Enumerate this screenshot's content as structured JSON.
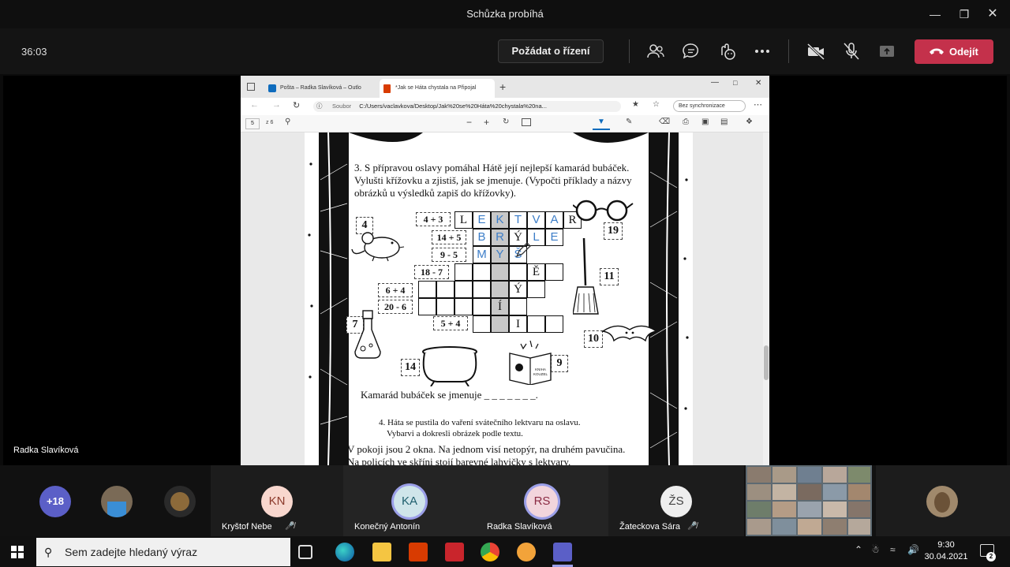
{
  "window": {
    "title": "Schůzka probíhá",
    "controls": [
      "minimize",
      "maximize",
      "close"
    ]
  },
  "meeting": {
    "timer": "36:03",
    "request_control_label": "Požádat o řízení",
    "leave_label": "Odejít",
    "leave_color": "#c4314b",
    "toolbar_icons": [
      "people-icon",
      "chat-icon",
      "reactions-icon",
      "more-icon",
      "camera-off-icon",
      "mic-off-icon",
      "share-icon"
    ]
  },
  "presenter_name": "Radka Slavíková",
  "browser": {
    "tabs": [
      {
        "label": "Pošta – Radka Slavíková – Outlo",
        "active": false
      },
      {
        "label": "*Jak se Háta chystala na Připojal",
        "active": true
      }
    ],
    "address_label": "Soubor",
    "url": "C:/Users/vaclavkova/Desktop/Jak%20se%20Háta%20chystala%20na...",
    "sync_label": "Bez synchronizace",
    "page_current": "5",
    "page_total": "z 6"
  },
  "worksheet": {
    "task3_lines": [
      "3. S přípravou oslavy pomáhal Hátě její nejlepší kamarád bubáček.",
      "Vylušti křížovku a zjistiš, jak se jmenuje. (Vypočti příklady a názvy",
      "obrázků u výsledků zapiš do křížovky)."
    ],
    "crossword_clues": [
      "4 + 3",
      "14 + 5",
      "9 - 5",
      "18 - 7",
      "6 + 4",
      "20 - 6",
      "5 + 4"
    ],
    "picture_numbers": [
      "4",
      "19",
      "11",
      "7",
      "10",
      "14",
      "9"
    ],
    "rows": [
      [
        "L",
        "E",
        "K",
        "T",
        "V",
        "A",
        "R"
      ],
      [
        "B",
        "R",
        "Ý",
        "L",
        "E"
      ],
      [
        "M",
        "Y",
        "Š"
      ],
      [
        "Ě"
      ],
      [
        "Ý"
      ],
      [
        "Í"
      ],
      [
        "I"
      ]
    ],
    "book_label": "KNIHA KOUZEL",
    "answer_line": "Kamarád bubáček se jmenuje _ _ _ _ _ _ _.",
    "task4_lines": [
      "4. Háta se pustila do vaření svátečního lektvaru na oslavu.",
      "Vybarvi a dokresli obrázek podle textu."
    ],
    "story_lines": [
      "V pokoji jsou 2 okna. Na jednom visí netopýr, na druhém pavučina.",
      "Na policích ve skříni stojí barevné lahvičky s lektvary."
    ]
  },
  "participants": {
    "overflow_count": "+18",
    "tiles": [
      {
        "initials": "KN",
        "name": "Kryštof Nebe",
        "muted": true
      },
      {
        "initials": "KA",
        "name": "Konečný Antonín",
        "muted": false
      },
      {
        "initials": "RS",
        "name": "Radka Slavíková",
        "muted": false
      },
      {
        "initials": "ŽS",
        "name": "Žateckova Sára",
        "muted": true
      }
    ]
  },
  "taskbar": {
    "search_placeholder": "Sem zadejte hledaný výraz",
    "time": "9:30",
    "date": "30.04.2021",
    "notification_count": "2",
    "apps": [
      "task-view-icon",
      "edge-icon",
      "explorer-icon",
      "office-icon",
      "acrobat-icon",
      "chrome-icon",
      "settings-icon",
      "teams-icon"
    ]
  }
}
